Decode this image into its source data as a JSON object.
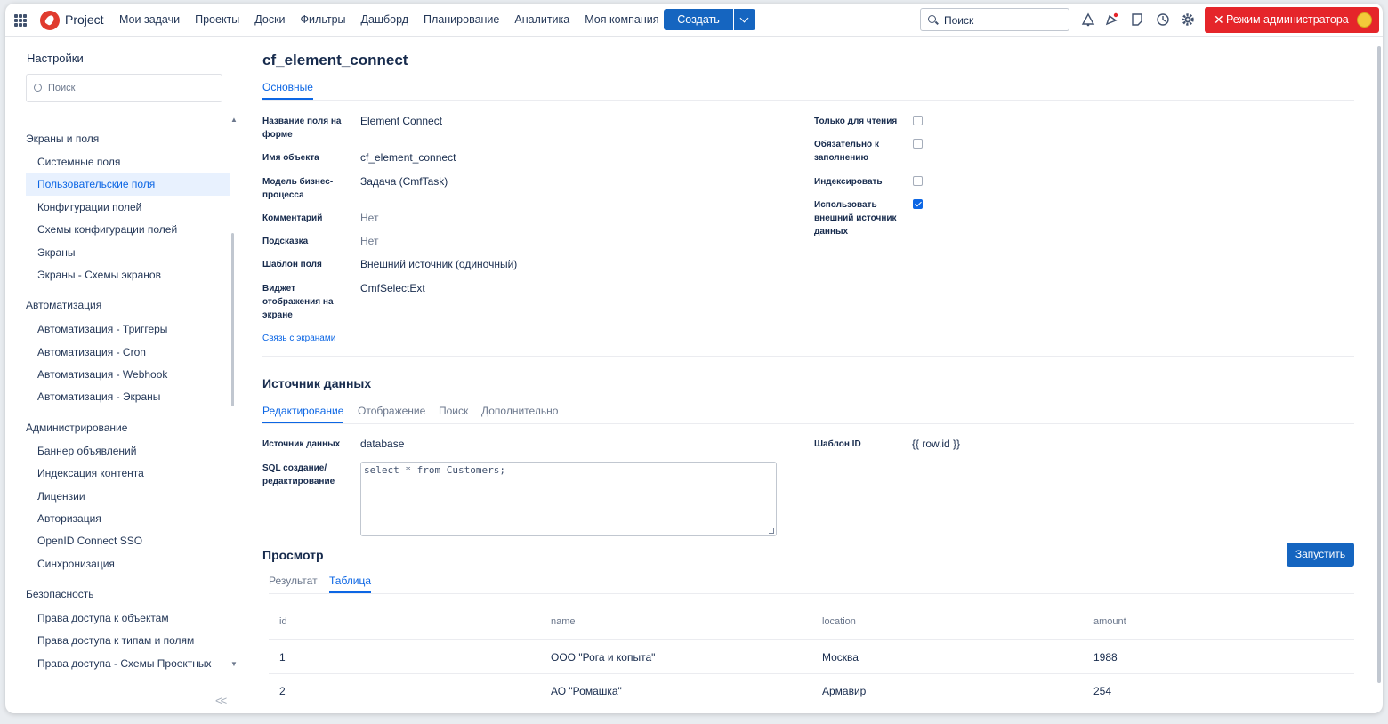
{
  "topbar": {
    "app_name": "Project",
    "nav": [
      "Мои задачи",
      "Проекты",
      "Доски",
      "Фильтры",
      "Дашборд",
      "Планирование",
      "Аналитика",
      "Моя компания"
    ],
    "create_label": "Создать",
    "search_placeholder": "Поиск",
    "admin_label": "Режим администратора"
  },
  "sidebar": {
    "title": "Настройки",
    "search_placeholder": "Поиск",
    "groups": [
      {
        "label": "Экраны и поля",
        "items": [
          "Системные поля",
          "Пользовательские поля",
          "Конфигурации полей",
          "Схемы конфигурации полей",
          "Экраны",
          "Экраны - Схемы экранов"
        ]
      },
      {
        "label": "Автоматизация",
        "items": [
          "Автоматизация - Триггеры",
          "Автоматизация - Cron",
          "Автоматизация - Webhook",
          "Автоматизация - Экраны"
        ]
      },
      {
        "label": "Администрирование",
        "items": [
          "Баннер объявлений",
          "Индексация контента",
          "Лицензии",
          "Авторизация",
          "OpenID Connect SSO",
          "Синхронизация"
        ]
      },
      {
        "label": "Безопасность",
        "items": [
          "Права доступа к объектам",
          "Права доступа к типам и полям",
          "Права доступа - Схемы Проектных"
        ]
      }
    ],
    "active_item": "Пользовательские поля",
    "collapse": "<<"
  },
  "page": {
    "title": "cf_element_connect",
    "tab_main": "Основные",
    "fields": [
      {
        "label": "Название поля на форме",
        "value": "Element Connect"
      },
      {
        "label": "Имя объекта",
        "value": "cf_element_connect"
      },
      {
        "label": "Модель бизнес-процесса",
        "value": "Задача (CmfTask)"
      },
      {
        "label": "Комментарий",
        "value": "Нет"
      },
      {
        "label": "Подсказка",
        "value": "Нет"
      },
      {
        "label": "Шаблон поля",
        "value": "Внешний источник (одиночный)"
      },
      {
        "label": "Виджет отображения на экране",
        "value": "CmfSelectExt"
      }
    ],
    "screens_link": "Связь с экранами",
    "flags": [
      {
        "label": "Только для чтения",
        "checked": false
      },
      {
        "label": "Обязательно к заполнению",
        "checked": false
      },
      {
        "label": "Индексировать",
        "checked": false
      },
      {
        "label": "Использовать внешний источник данных",
        "checked": true
      }
    ]
  },
  "datasource": {
    "title": "Источник данных",
    "tabs": [
      "Редактирование",
      "Отображение",
      "Поиск",
      "Дополнительно"
    ],
    "source_label": "Источник данных",
    "source_value": "database",
    "sql_label": "SQL создание/ редактирование",
    "sql_value": "select * from Customers;",
    "template_label": "Шаблон ID",
    "template_value": "{{ row.id }}"
  },
  "preview": {
    "title": "Просмотр",
    "run_label": "Запустить",
    "tabs": [
      "Результат",
      "Таблица"
    ],
    "columns": [
      "id",
      "name",
      "location",
      "amount"
    ],
    "rows": [
      [
        "1",
        "ООО \"Рога и копыта\"",
        "Москва",
        "1988"
      ],
      [
        "2",
        "АО \"Ромашка\"",
        "Армавир",
        "254"
      ]
    ]
  }
}
